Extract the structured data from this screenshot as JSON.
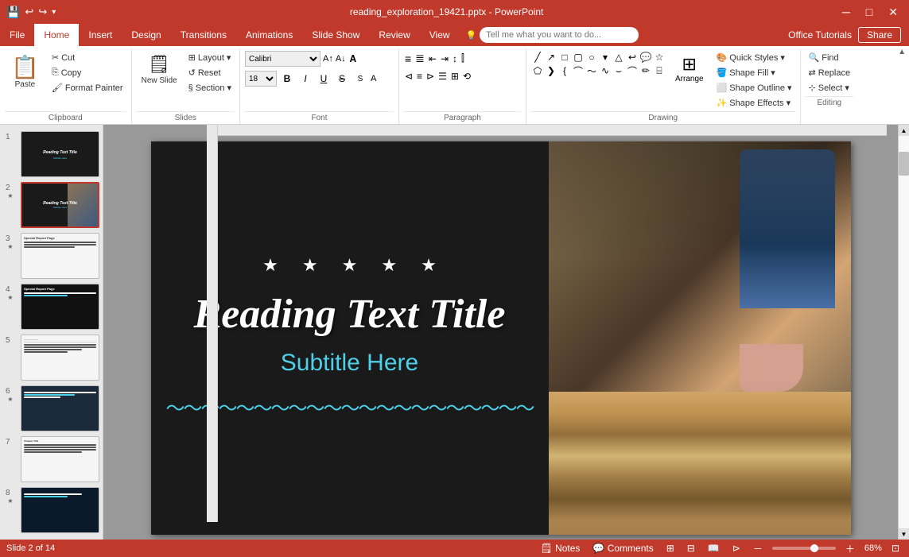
{
  "titlebar": {
    "title": "reading_exploration_19421.pptx - PowerPoint",
    "controls": [
      "minimize",
      "maximize",
      "close"
    ]
  },
  "menubar": {
    "items": [
      "File",
      "Home",
      "Insert",
      "Design",
      "Transitions",
      "Animations",
      "Slide Show",
      "Review",
      "View"
    ],
    "active": "Home",
    "search_placeholder": "Tell me what you want to do...",
    "right_items": [
      "Office Tutorials",
      "Share"
    ]
  },
  "ribbon": {
    "clipboard": {
      "label": "Clipboard",
      "paste": "Paste",
      "cut": "Cut",
      "copy": "Copy",
      "format_painter": "Format Painter"
    },
    "slides": {
      "label": "Slides",
      "new_slide": "New Slide",
      "layout": "Layout",
      "reset": "Reset",
      "section": "Section"
    },
    "font": {
      "label": "Font",
      "font_name": "Calibri",
      "font_size": "18"
    },
    "paragraph": {
      "label": "Paragraph"
    },
    "drawing": {
      "label": "Drawing",
      "arrange": "Arrange",
      "quick_styles": "Quick Styles",
      "shape_fill": "Shape Fill",
      "shape_outline": "Shape Outline",
      "shape_effects": "Shape Effects"
    },
    "editing": {
      "label": "Editing",
      "find": "Find",
      "replace": "Replace",
      "select": "Select"
    }
  },
  "slide_panel": {
    "slides": [
      {
        "num": "1",
        "starred": false,
        "type": "title"
      },
      {
        "num": "2",
        "starred": true,
        "type": "active"
      },
      {
        "num": "3",
        "starred": true,
        "type": "content"
      },
      {
        "num": "4",
        "starred": true,
        "type": "dark-content"
      },
      {
        "num": "5",
        "starred": false,
        "type": "text"
      },
      {
        "num": "6",
        "starred": true,
        "type": "text2"
      },
      {
        "num": "7",
        "starred": false,
        "type": "text3"
      },
      {
        "num": "8",
        "starred": true,
        "type": "dark2"
      }
    ]
  },
  "slide": {
    "stars": [
      "★",
      "★",
      "★",
      "★",
      "★"
    ],
    "title": "Reading Text Title",
    "subtitle": "Subtitle Here",
    "decoration": "〜〜〜〜〜〜〜〜〜〜〜〜〜〜〜〜〜〜〜〜〜"
  },
  "statusbar": {
    "slide_info": "Slide 2 of 14",
    "notes": "Notes",
    "comments": "Comments",
    "zoom_level": "68%"
  }
}
